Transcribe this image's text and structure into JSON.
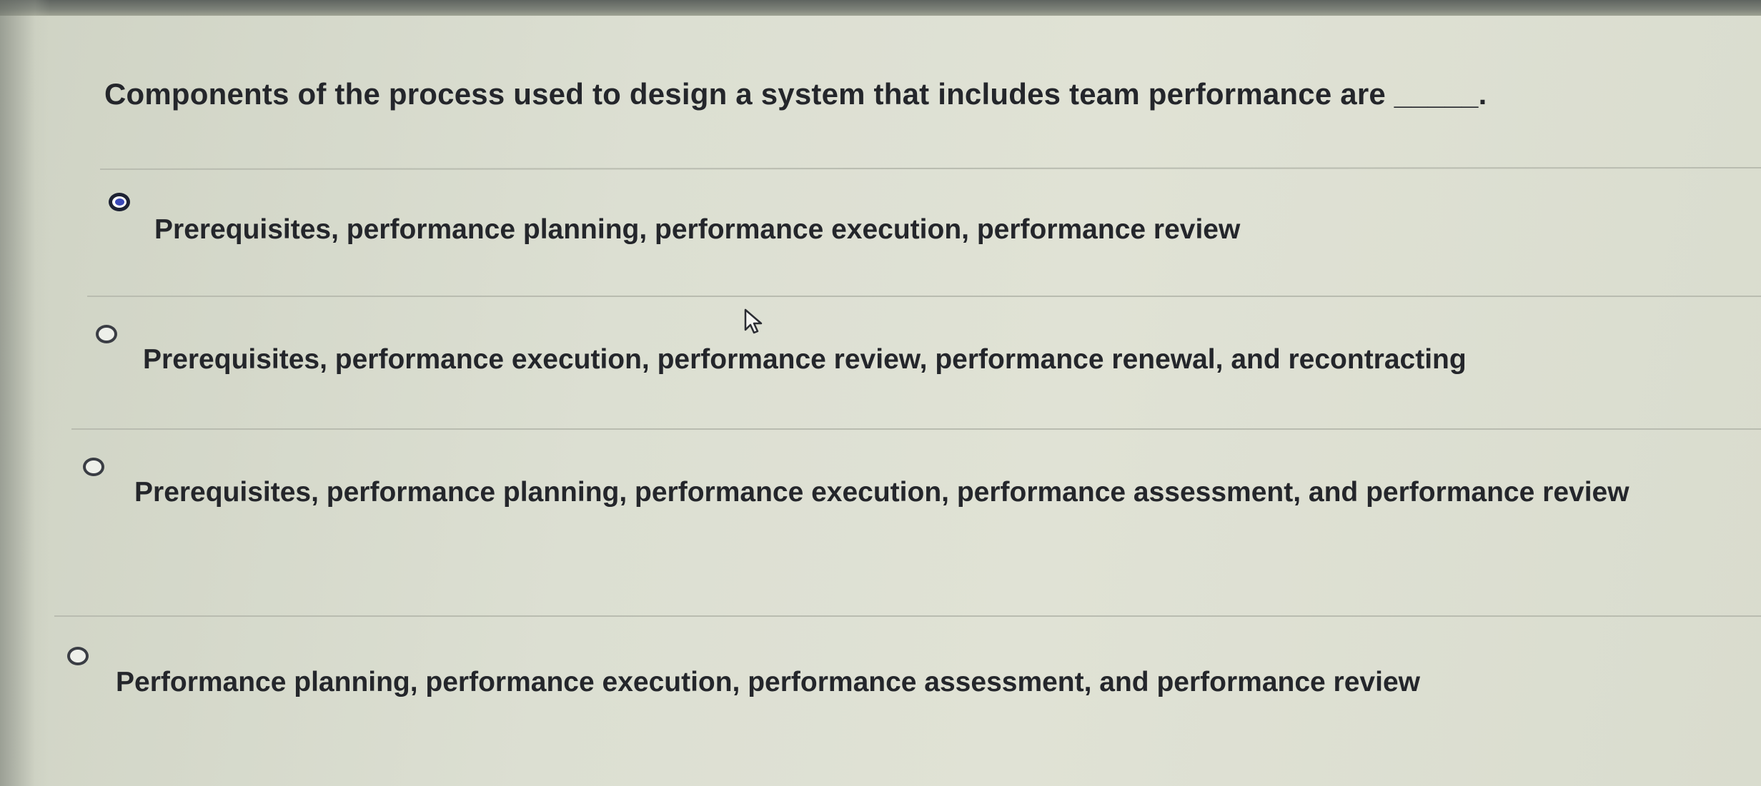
{
  "quiz": {
    "question": "Components of the process used to design a system that includes team performance are _____.",
    "options": [
      {
        "label": "Prerequisites, performance planning, performance execution, performance review",
        "selected": true
      },
      {
        "label": "Prerequisites, performance execution, performance review, performance renewal, and recontracting",
        "selected": false
      },
      {
        "label": "Prerequisites, performance planning, performance execution, performance assessment, and performance review",
        "selected": false
      },
      {
        "label": "Performance planning, performance execution, performance assessment, and performance review",
        "selected": false
      }
    ]
  },
  "icons": {
    "radio_selected": "radio-selected-icon",
    "radio_unselected": "radio-unselected-icon",
    "cursor": "mouse-pointer-icon"
  },
  "colors": {
    "radio_fill": "#3b49b8",
    "background": "#dcdfd2",
    "text": "#24262b"
  }
}
